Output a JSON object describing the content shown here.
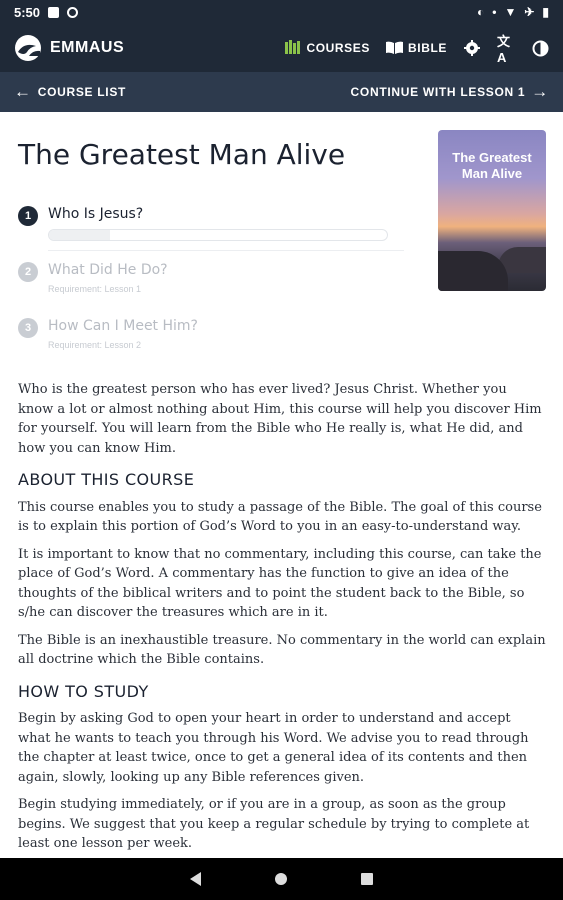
{
  "status": {
    "time": "5:50"
  },
  "app": {
    "brand": "EMMAUS",
    "nav": {
      "courses": "COURSES",
      "bible": "BIBLE"
    }
  },
  "subbar": {
    "back": "COURSE LIST",
    "next": "CONTINUE WITH LESSON 1"
  },
  "course": {
    "title": "The Greatest Man Alive",
    "cover_title": "The Greatest Man Alive",
    "lessons": [
      {
        "num": "1",
        "title": "Who Is Jesus?",
        "progress": 0.18
      },
      {
        "num": "2",
        "title": "What Did He Do?",
        "requirement": "Requirement: Lesson 1"
      },
      {
        "num": "3",
        "title": "How Can I Meet Him?",
        "requirement": "Requirement: Lesson 2"
      }
    ],
    "intro": "Who is the greatest person who has ever lived? Jesus Christ. Whether you know a lot or almost nothing about Him, this course will help you discover Him for yourself. You will learn from the Bible who He really is, what He did, and how you can know Him.",
    "about_heading": "ABOUT THIS COURSE",
    "about": [
      "This course enables you to study a passage of the Bible. The goal of this course is to explain this portion of God’s Word to you in an easy-to-understand way.",
      "It is important to know that no commentary, including this course, can take the place of God’s Word. A commentary has the function to give an idea of the thoughts of the biblical writers and to point the student back to the Bible, so s/he can discover the treasures which are in it.",
      "The Bible is an inexhaustible treasure. No commentary in the world can explain all doctrine which the Bible contains."
    ],
    "study_heading": "HOW TO STUDY",
    "study": [
      "Begin by asking God to open your heart in order to understand and accept what he wants to teach you through his Word. We advise you to read through the chapter at least twice, once to get a general idea of its contents and then again, slowly, looking up any Bible references given.",
      "Begin studying immediately, or if you are in a group, as soon as the group begins. We suggest that you keep a regular schedule by trying to complete at least one lesson per week."
    ]
  },
  "colors": {
    "appbar": "#1f2937",
    "subbar": "#2d3a4d",
    "accent": "#8bc34a"
  },
  "icons": [
    "logo-icon",
    "courses-icon",
    "bible-icon",
    "settings-icon",
    "translate-icon",
    "contrast-icon",
    "arrow-left-icon",
    "arrow-right-icon"
  ]
}
